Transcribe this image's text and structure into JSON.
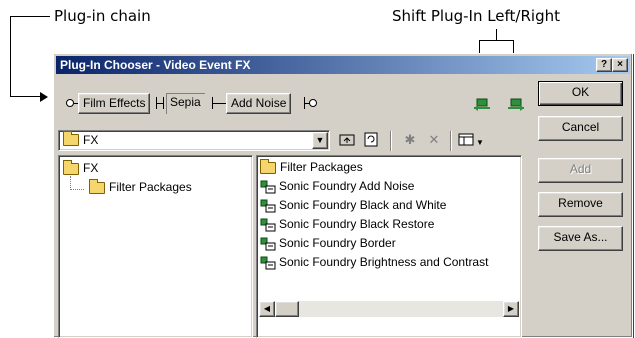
{
  "callouts": {
    "plugin_chain": "Plug-in chain",
    "shift_plugin": "Shift Plug-In Left/Right"
  },
  "dialog": {
    "title": "Plug-In Chooser - Video Event FX",
    "help_btn": "?",
    "close_btn": "×"
  },
  "chain": {
    "items": [
      "Film Effects",
      "Sepia",
      "Add Noise"
    ]
  },
  "path": {
    "value": "FX"
  },
  "buttons": {
    "ok": "OK",
    "cancel": "Cancel",
    "add": "Add",
    "remove": "Remove",
    "save_as": "Save As..."
  },
  "tree": {
    "root": "FX",
    "child": "Filter Packages"
  },
  "list": {
    "items": [
      {
        "label": "Filter Packages",
        "icon": "folder-icon"
      },
      {
        "label": "Sonic Foundry Add Noise",
        "icon": "plugin-icon"
      },
      {
        "label": "Sonic Foundry Black and White",
        "icon": "plugin-icon"
      },
      {
        "label": "Sonic Foundry Black Restore",
        "icon": "plugin-icon"
      },
      {
        "label": "Sonic Foundry Border",
        "icon": "plugin-icon"
      },
      {
        "label": "Sonic Foundry Brightness and Contrast",
        "icon": "plugin-icon"
      }
    ]
  },
  "colors": {
    "title_start": "#0a246a",
    "title_end": "#a6caf0",
    "face": "#d4d0c8",
    "plugin_green": "#2f8f3a"
  }
}
